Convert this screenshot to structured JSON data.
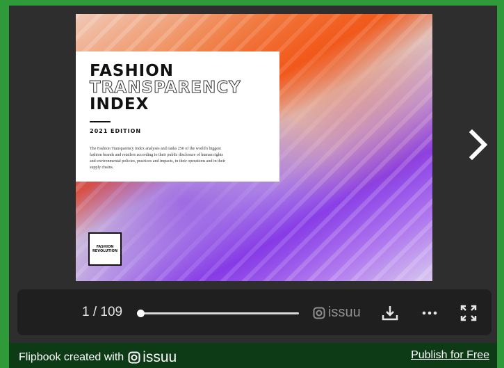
{
  "document": {
    "title_line1": "FASHION",
    "title_line2": "TRANSPARENCY",
    "title_line3": "INDEX",
    "edition": "2021 EDITION",
    "blurb": "The Fashion Transparency Index analyses and ranks 250 of the world's biggest fashion brands and retailers according to their public disclosure of human rights and environmental policies, practices and impacts, in their operations and in their supply chains.",
    "logo_text": "FASHION REVOLUTION"
  },
  "controls": {
    "page_counter": "1 / 109",
    "progress": 0.01,
    "brand": "issuu",
    "icons": [
      "issuu-logo-icon",
      "download-icon",
      "more-icon",
      "fullscreen-icon",
      "chevron-right-icon"
    ]
  },
  "footer": {
    "prefix": "Flipbook created with",
    "brand": "issuu",
    "publish_label": "Publish for Free"
  },
  "colors": {
    "frame_background": "#2e2e2e",
    "outer_border": "#2f9a3a",
    "footer_background": "#0c3b16",
    "controls_background": "#1f1f1f"
  }
}
